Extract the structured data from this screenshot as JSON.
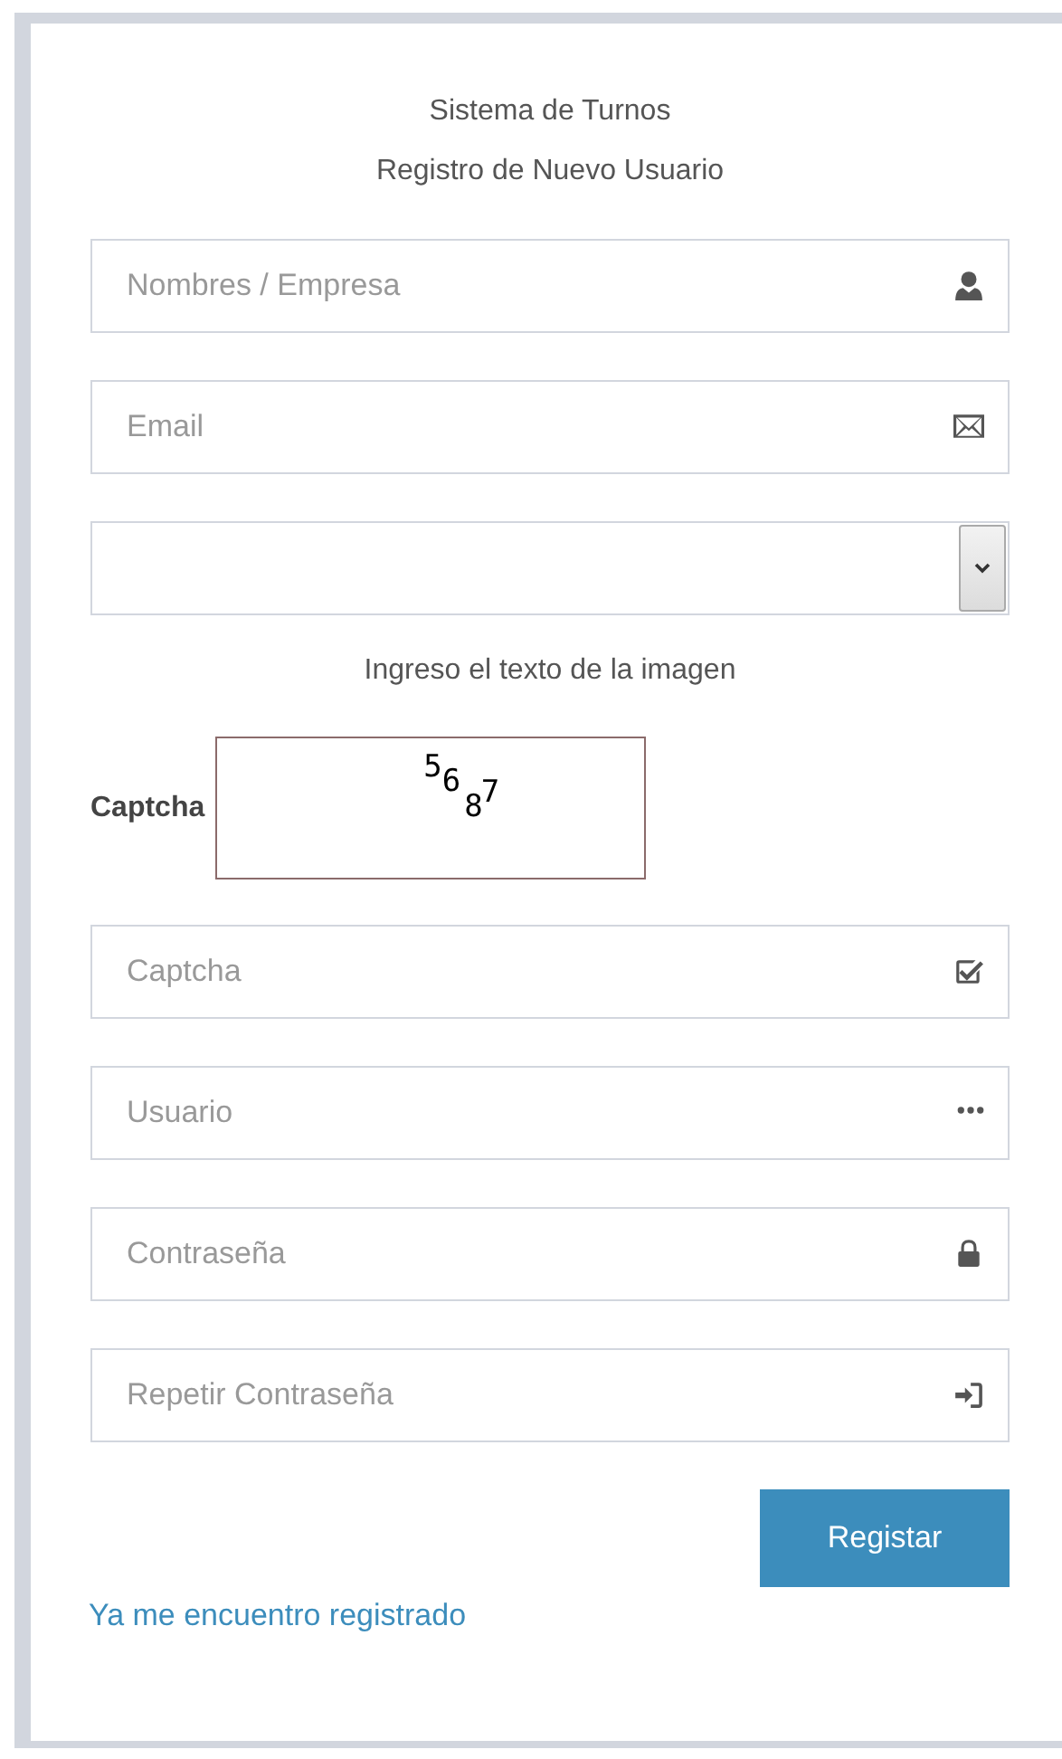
{
  "header": {
    "system_title": "Sistema de Turnos",
    "form_title": "Registro de Nuevo Usuario"
  },
  "fields_top": [
    {
      "kind": "text",
      "placeholder": "Nombres / Empresa"
    },
    {
      "kind": "text",
      "placeholder": "Email"
    },
    {
      "kind": "select"
    }
  ],
  "captcha": {
    "instruction": "Ingreso el texto de la imagen",
    "label": "Captcha",
    "image_characters": [
      "5",
      "6",
      "8",
      "7"
    ]
  },
  "fields_bottom": [
    {
      "kind": "text",
      "placeholder": "Captcha"
    },
    {
      "kind": "text",
      "placeholder": "Usuario"
    },
    {
      "kind": "text",
      "placeholder": "Contraseña"
    },
    {
      "kind": "text",
      "placeholder": "Repetir Contraseña"
    }
  ],
  "submit_button": "Registar",
  "login_link": "Ya me encuentro registrado"
}
